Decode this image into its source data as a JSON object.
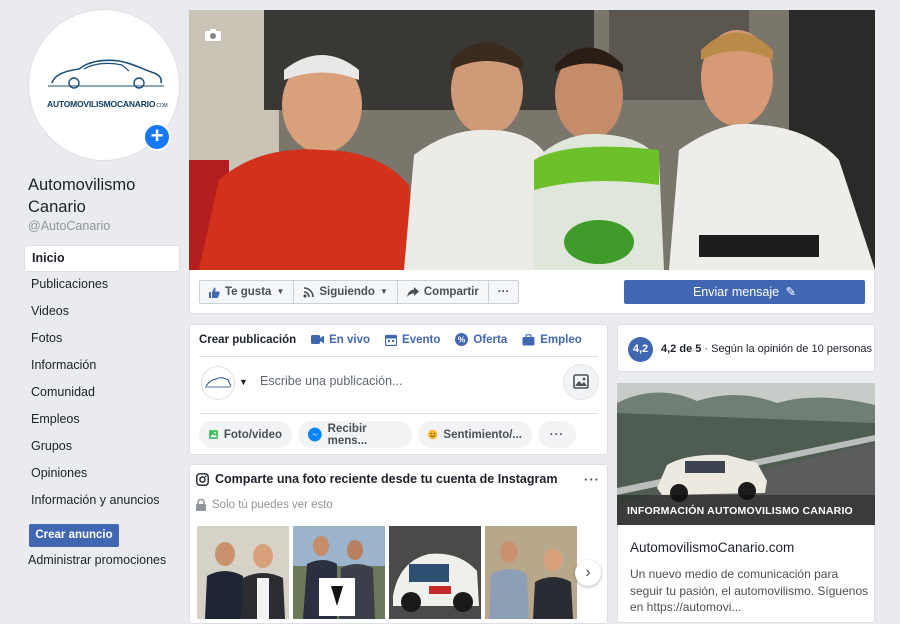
{
  "page": {
    "name": "Automovilismo Canario",
    "handle": "@AutoCanario",
    "logo_text": "AUTOMOVILISMOCANARIO",
    "logo_suffix": ".COM"
  },
  "nav": {
    "items": [
      "Inicio",
      "Publicaciones",
      "Videos",
      "Fotos",
      "Información",
      "Comunidad",
      "Empleos",
      "Grupos",
      "Opiniones",
      "Información y anuncios"
    ],
    "active_index": 0,
    "create_ad": "Crear anuncio",
    "promotions": "Administrar promociones"
  },
  "actions": {
    "like": "Te gusta",
    "follow": "Siguiendo",
    "share": "Compartir",
    "more": "···",
    "send_message": "Enviar mensaje"
  },
  "composer": {
    "tabs": [
      "Crear publicación",
      "En vivo",
      "Evento",
      "Oferta",
      "Empleo"
    ],
    "placeholder": "Escribe una publicación...",
    "photo_video": "Foto/video",
    "receive_messages": "Recibir mens...",
    "feeling": "Sentimiento/...",
    "more": "···"
  },
  "instagram": {
    "title": "Comparte una foto reciente desde tu cuenta de Instagram",
    "subtitle": "Solo tú puedes ver esto",
    "more": "···"
  },
  "rating": {
    "score": "4,2",
    "of": "4,2 de 5",
    "text": "· Según la opinión de 10 personas"
  },
  "about": {
    "image_label": "INFORMACIÓN AUTOMOVILISMO CANARIO",
    "title": "AutomovilismoCanario.com",
    "description": "Un nuevo medio de comunicación para seguir tu pasión, el automovilismo. Síguenos en https://automovi..."
  },
  "colors": {
    "brand": "#4267b2",
    "page_bg": "#e9ebee",
    "accent_blue": "#1877f2"
  }
}
